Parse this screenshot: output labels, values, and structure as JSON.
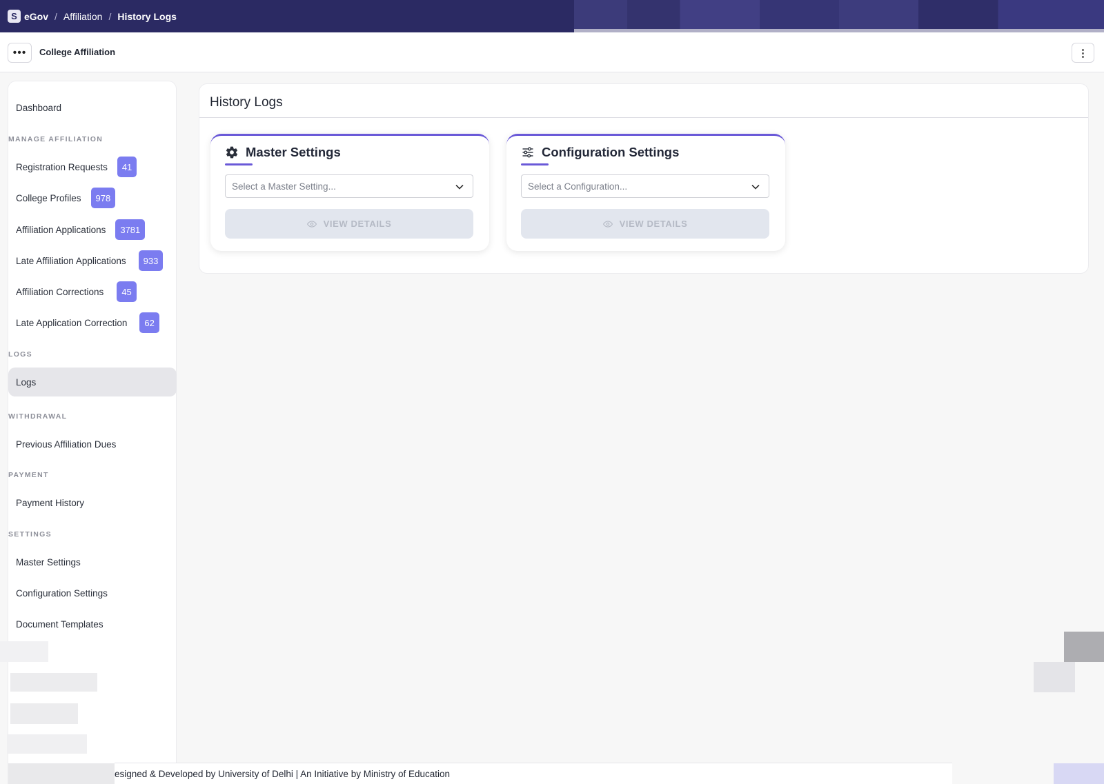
{
  "topbar": {
    "logo_letter": "S",
    "brand": "eGov",
    "breadcrumb": [
      "Affiliation",
      "History Logs"
    ],
    "separator": "/"
  },
  "subheader": {
    "menu_icon": "ellipsis-icon",
    "title": "College Affiliation",
    "more_icon": "kebab-icon"
  },
  "sidebar": {
    "dashboard": "Dashboard",
    "sections": {
      "manage": "MANAGE AFFILIATION",
      "logs": "LOGS",
      "withdrawal": "WITHDRAWAL",
      "payment": "PAYMENT",
      "settings": "SETTINGS"
    },
    "manage_items": [
      {
        "label": "Registration Requests",
        "count": "41"
      },
      {
        "label": "College Profiles",
        "count": "978"
      },
      {
        "label": "Affiliation Applications",
        "count": "3781"
      },
      {
        "label": "Late Affiliation Applications",
        "count": "933"
      },
      {
        "label": "Affiliation Corrections",
        "count": "45"
      },
      {
        "label": "Late Application Correction",
        "count": "62"
      }
    ],
    "logs_items": [
      "Logs"
    ],
    "withdrawal_items": [
      "Previous Affiliation Dues"
    ],
    "payment_items": [
      "Payment History"
    ],
    "settings_items": [
      "Master Settings",
      "Configuration Settings",
      "Document Templates"
    ],
    "active_item": "Logs"
  },
  "main": {
    "title": "History Logs",
    "cards": [
      {
        "title": "Master Settings",
        "icon": "gear-icon",
        "placeholder": "Select a Master Setting...",
        "button": "VIEW DETAILS"
      },
      {
        "title": "Configuration Settings",
        "icon": "sliders-icon",
        "placeholder": "Select a Configuration...",
        "button": "VIEW DETAILS"
      }
    ]
  },
  "footer": {
    "text": "esigned & Developed by University of Delhi | An Initiative by Ministry of Education"
  },
  "colors": {
    "topbar": "#2b2a63",
    "badge": "#7b7cf0",
    "accent": "#6a59d8"
  }
}
